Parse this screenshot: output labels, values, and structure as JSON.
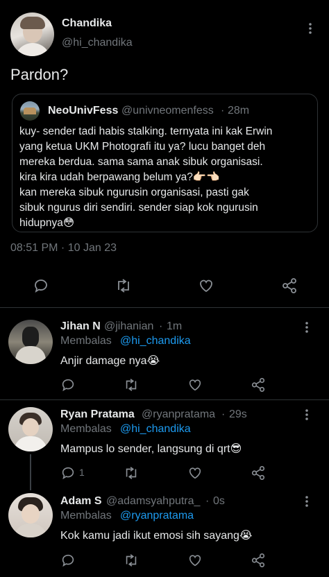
{
  "main_tweet": {
    "author_name": "Chandika",
    "author_handle": "@hi_chandika",
    "text": "Pardon?",
    "quoted": {
      "author_name": "NeoUnivFess",
      "author_handle": "@univneomenfess",
      "separator": "·",
      "time": "28m",
      "lines": [
        "kuy- sender tadi habis stalking. ternyata ini kak Erwin",
        "yang ketua UKM Photografi itu ya? lucu banget deh",
        "mereka berdua. sama sama anak sibuk organisasi.",
        "kira kira udah berpawang belum ya?👉🏻👈🏻",
        "kan mereka sibuk ngurusin organisasi, pasti gak",
        "sibuk ngurus diri sendiri. sender siap kok ngurusin",
        "hidupnya😳"
      ]
    },
    "timestamp": "08:51 PM · 10 Jan 23"
  },
  "replies": [
    {
      "name": "Jihan N",
      "handle": "@jihanian",
      "separator": "·",
      "time": "1m",
      "replying_label": "Membalas",
      "replying_to": "@hi_chandika",
      "text": "Anjir damage nya😭",
      "reply_count": ""
    },
    {
      "name": "Ryan Pratama",
      "handle": "@ryanpratama",
      "separator": "·",
      "time": "29s",
      "replying_label": "Membalas",
      "replying_to": "@hi_chandika",
      "text": "Mampus lo sender, langsung di qrt😎",
      "reply_count": "1"
    },
    {
      "name": "Adam S",
      "handle": "@adamsyahputra_",
      "separator": "·",
      "time": "0s",
      "replying_label": "Membalas",
      "replying_to": "@ryanpratama",
      "text": "Kok kamu jadi ikut emosi sih sayang😭",
      "reply_count": ""
    }
  ],
  "colors": {
    "background": "#000000",
    "text": "#e7e9ea",
    "muted": "#71767b",
    "link": "#1d9bf0",
    "border": "#2f3336"
  },
  "icons": [
    "more-icon",
    "reply-icon",
    "retweet-icon",
    "like-icon",
    "share-icon"
  ]
}
